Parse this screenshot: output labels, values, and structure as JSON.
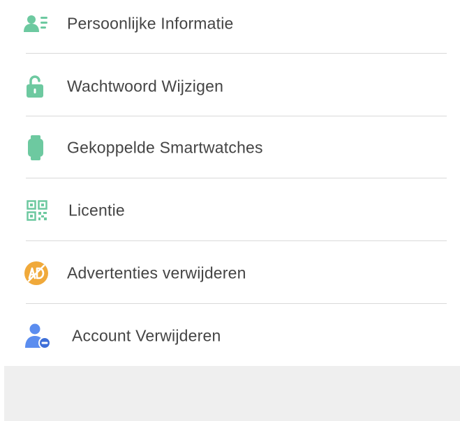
{
  "colors": {
    "accent_green": "#6DC9A0",
    "ad_orange": "#F0A93A",
    "account_blue": "#5B8DEF",
    "text": "#444444",
    "divider": "#D9D9D9",
    "footer_bg": "#EFEFEF"
  },
  "menu": {
    "items": [
      {
        "label": "Persoonlijke Informatie",
        "icon": "person-info-icon"
      },
      {
        "label": "Wachtwoord Wijzigen",
        "icon": "lock-icon"
      },
      {
        "label": "Gekoppelde Smartwatches",
        "icon": "smartwatch-icon"
      },
      {
        "label": "Licentie",
        "icon": "qr-code-icon"
      },
      {
        "label": "Advertenties verwijderen",
        "icon": "no-ads-icon"
      },
      {
        "label": "Account Verwijderen",
        "icon": "remove-account-icon"
      }
    ]
  }
}
